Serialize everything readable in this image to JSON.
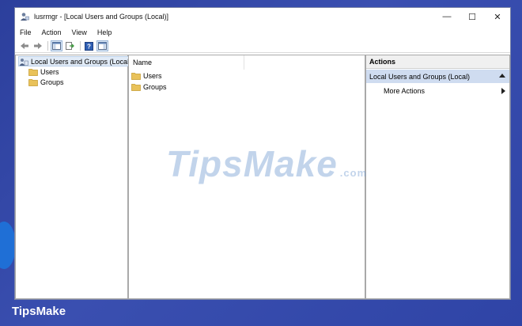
{
  "window": {
    "title": "lusrmgr - [Local Users and Groups (Local)]",
    "controls": {
      "minimize": "—",
      "maximize": "☐",
      "close": "✕"
    }
  },
  "menubar": [
    "File",
    "Action",
    "View",
    "Help"
  ],
  "toolbar": {
    "icons": [
      "back-arrow-icon",
      "forward-arrow-icon",
      "show-hide-tree-icon",
      "export-list-icon",
      "help-icon",
      "show-hide-action-pane-icon"
    ]
  },
  "tree": {
    "root": "Local Users and Groups (Local)",
    "children": [
      "Users",
      "Groups"
    ]
  },
  "center": {
    "column_header": "Name",
    "items": [
      "Users",
      "Groups"
    ]
  },
  "actions": {
    "header": "Actions",
    "section": "Local Users and Groups (Local)",
    "items": [
      "More Actions"
    ]
  },
  "watermark": {
    "main": "TipsMake",
    "suffix": ".com"
  },
  "footer_brand": "TipsMake",
  "colors": {
    "desktop_blue": "#3c4ea8",
    "selection": "#cfdcf0",
    "folder": "#e9c25a"
  }
}
